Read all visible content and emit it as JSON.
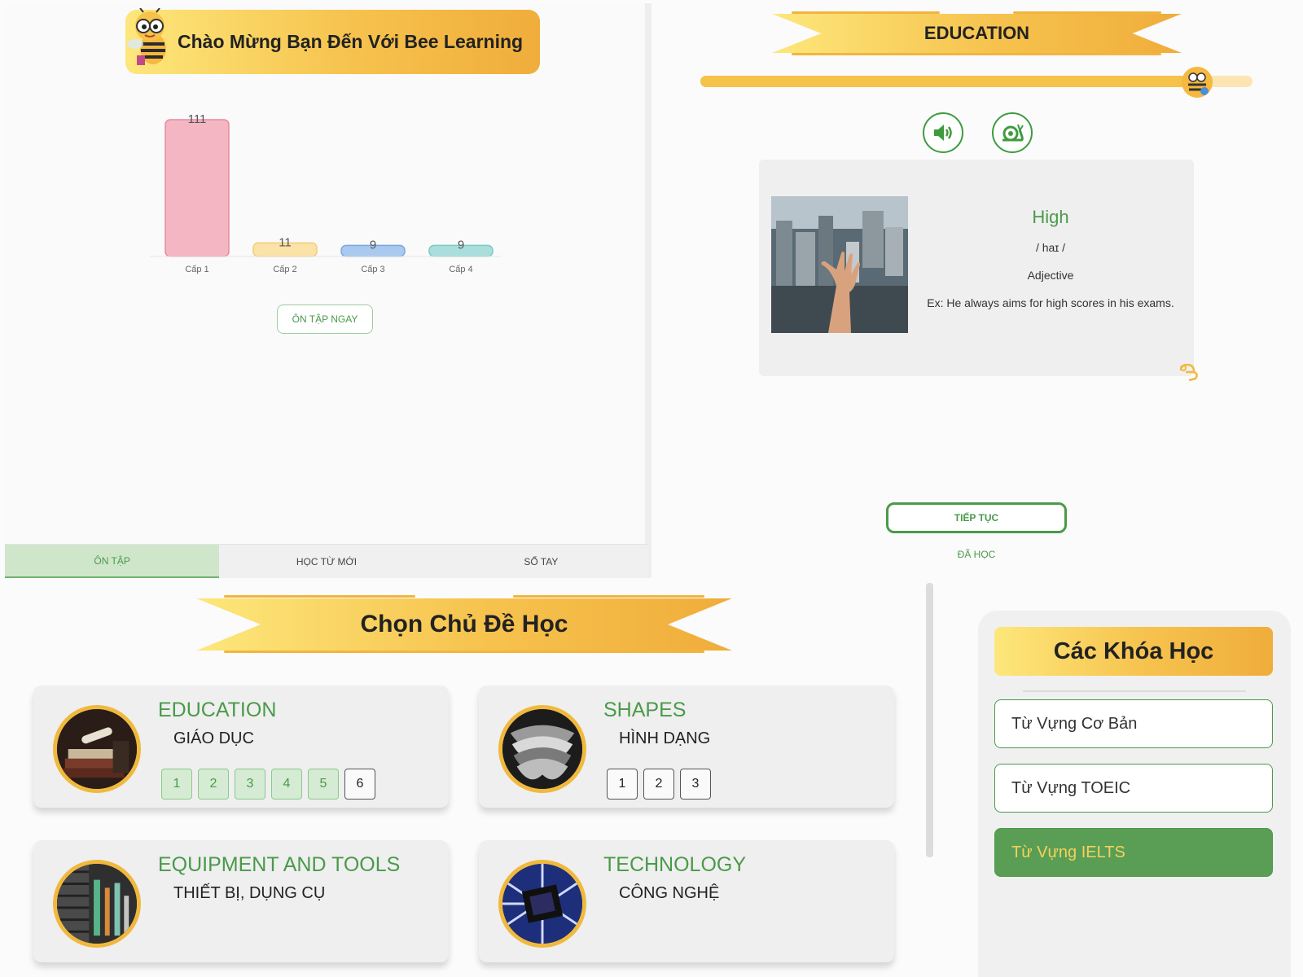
{
  "welcome": {
    "title": "Chào Mừng Bạn Đến Với Bee Learning"
  },
  "chart_data": {
    "type": "bar",
    "categories": [
      "Cấp 1",
      "Cấp 2",
      "Cấp 3",
      "Cấp 4"
    ],
    "values": [
      111,
      11,
      9,
      9
    ],
    "colors": [
      "#f5b6c3",
      "#fbe2a6",
      "#a9c9ee",
      "#a9dedd"
    ],
    "strokes": [
      "#e58aa0",
      "#f3cd78",
      "#7aa8e0",
      "#7ccac6"
    ],
    "title": "",
    "xlabel": "",
    "ylabel": "",
    "ylim": [
      0,
      111
    ],
    "grid": false
  },
  "review": {
    "button_label": "ÔN TẬP NGAY"
  },
  "tabs": [
    {
      "label": "ÔN TẬP",
      "active": true
    },
    {
      "label": "HỌC TỪ MỚI",
      "active": false
    },
    {
      "label": "SỔ TAY",
      "active": false
    }
  ],
  "flashcard": {
    "topic": "EDUCATION",
    "progress": 0.9,
    "word": "High",
    "phonetic": "/ haɪ /",
    "part_of_speech": "Adjective",
    "example": "Ex: He always aims for high scores in his exams.",
    "icons": [
      "speaker-icon",
      "snail-icon",
      "flip-icon"
    ],
    "continue_label": "TIẾP TỤC",
    "learned_label": "ĐÃ HỌC"
  },
  "topics": {
    "heading": "Chọn Chủ Đề Học",
    "items": [
      {
        "title": "EDUCATION",
        "subtitle": "GIÁO DỤC",
        "levels": [
          "1",
          "2",
          "3",
          "4",
          "5",
          "6"
        ],
        "completed": 5
      },
      {
        "title": "SHAPES",
        "subtitle": "HÌNH DẠNG",
        "levels": [
          "1",
          "2",
          "3"
        ],
        "completed": 0
      },
      {
        "title": "EQUIPMENT AND TOOLS",
        "subtitle": "THIẾT BỊ, DỤNG CỤ",
        "levels": [],
        "completed": 0
      },
      {
        "title": "TECHNOLOGY",
        "subtitle": "CÔNG NGHỆ",
        "levels": [],
        "completed": 0
      }
    ]
  },
  "courses": {
    "title": "Các Khóa Học",
    "items": [
      {
        "label": "Từ Vựng Cơ Bản",
        "active": false
      },
      {
        "label": "Từ Vựng TOEIC",
        "active": false
      },
      {
        "label": "Từ Vựng IELTS",
        "active": true
      }
    ]
  },
  "colors": {
    "accent_green": "#4a9a4a",
    "gold": "#f6c24d",
    "active_course": "#5a9e55"
  }
}
